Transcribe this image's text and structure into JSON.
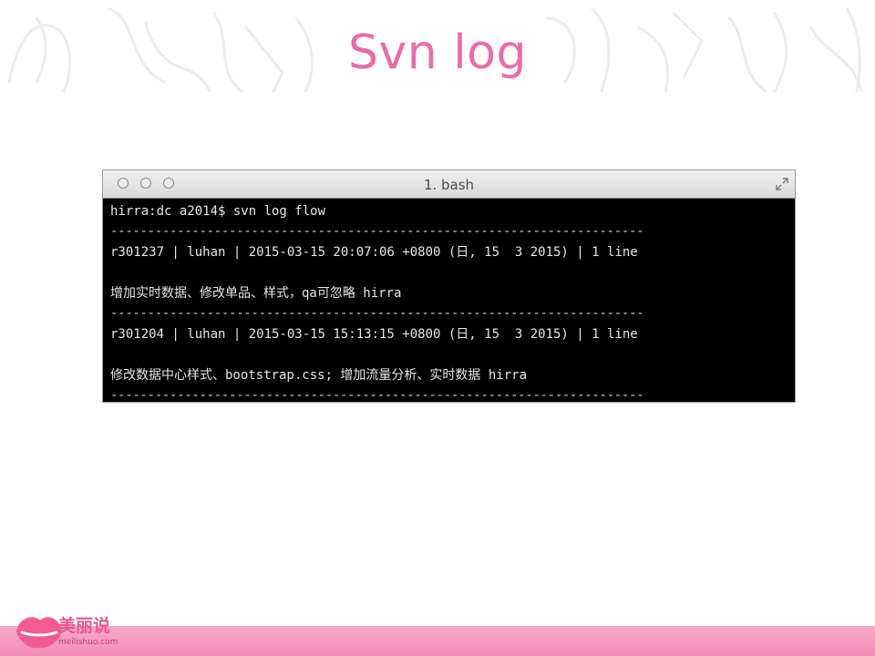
{
  "slide": {
    "title": "Svn log"
  },
  "terminal": {
    "window_title": "1. bash",
    "lines": [
      "hirra:dc a2014$ svn log flow",
      "------------------------------------------------------------------------",
      "r301237 | luhan | 2015-03-15 20:07:06 +0800 (日, 15  3 2015) | 1 line",
      "",
      "增加实时数据、修改单品、样式，qa可忽略 hirra",
      "------------------------------------------------------------------------",
      "r301204 | luhan | 2015-03-15 15:13:15 +0800 (日, 15  3 2015) | 1 line",
      "",
      "修改数据中心样式、bootstrap.css; 增加流量分析、实时数据 hirra",
      "------------------------------------------------------------------------"
    ]
  },
  "brand": {
    "name": "美丽说",
    "url": "meilishuo.com",
    "accent": "#ee6aa7"
  },
  "icons": [
    "close-button-icon",
    "minimize-button-icon",
    "zoom-button-icon",
    "resize-icon",
    "lips-logo-icon"
  ]
}
